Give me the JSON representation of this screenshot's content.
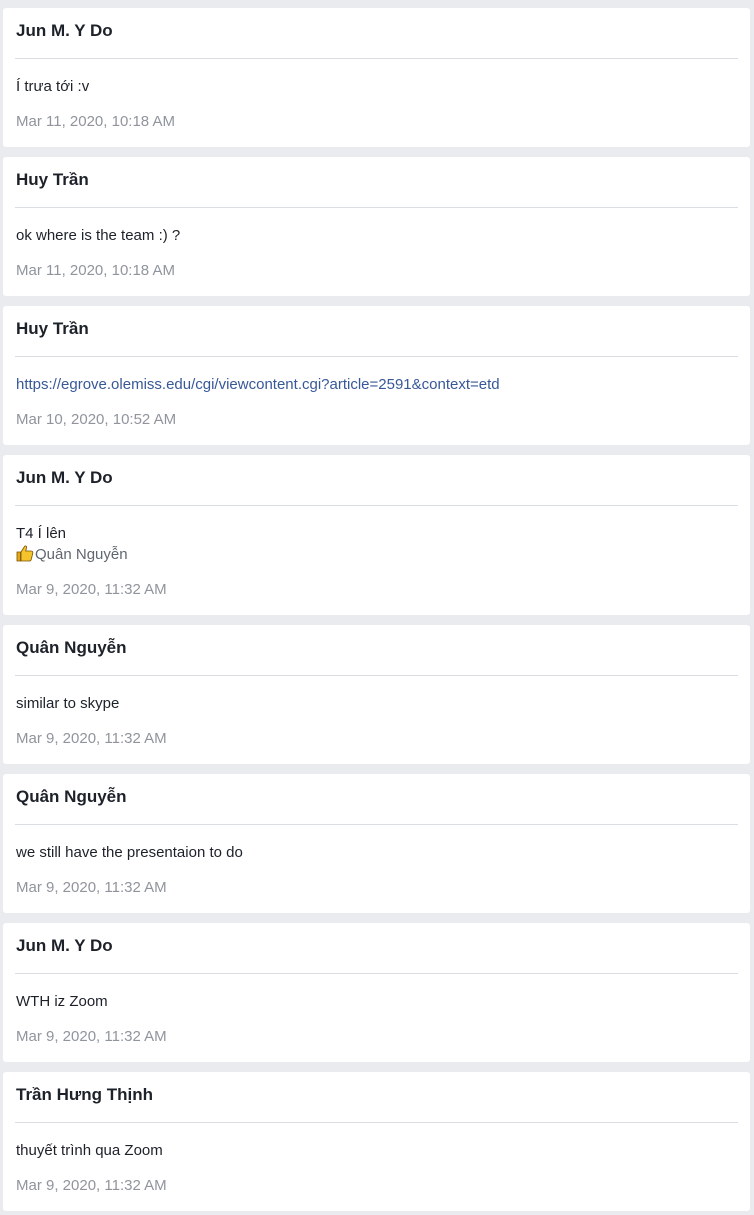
{
  "posts": [
    {
      "author": "Jun M. Y Do",
      "text": "Í trưa tới :v",
      "time": "Mar 11, 2020, 10:18 AM"
    },
    {
      "author": "Huy Trần",
      "text": "ok where is the team :) ?",
      "time": "Mar 11, 2020, 10:18 AM"
    },
    {
      "author": "Huy Trần",
      "link": "https://egrove.olemiss.edu/cgi/viewcontent.cgi?article=2591&context=etd",
      "time": "Mar 10, 2020, 10:52 AM"
    },
    {
      "author": "Jun M. Y Do",
      "text": "T4 Í lên",
      "reaction_user": "Quân Nguyễn",
      "reaction_icon": "thumbs-up-icon",
      "time": "Mar 9, 2020, 11:32 AM"
    },
    {
      "author": "Quân Nguyễn",
      "text": "similar to skype",
      "time": "Mar 9, 2020, 11:32 AM"
    },
    {
      "author": "Quân Nguyễn",
      "text": "we still have the presentaion to do",
      "time": "Mar 9, 2020, 11:32 AM"
    },
    {
      "author": "Jun M. Y Do",
      "text": "WTH iz Zoom",
      "time": "Mar 9, 2020, 11:32 AM"
    },
    {
      "author": "Trần Hưng Thịnh",
      "text": "thuyết trình qua Zoom",
      "time": "Mar 9, 2020, 11:32 AM"
    }
  ]
}
